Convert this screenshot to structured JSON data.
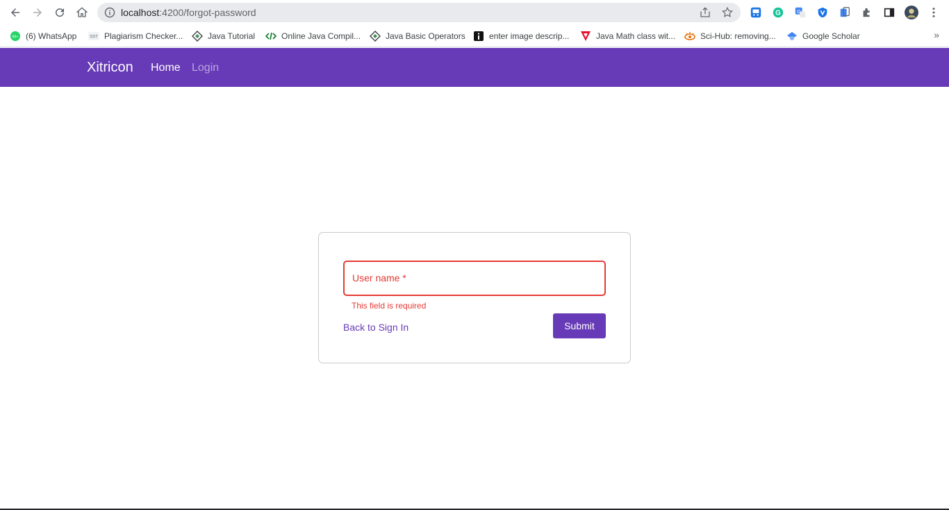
{
  "browser": {
    "url_host": "localhost",
    "url_path": ":4200/forgot-password"
  },
  "bookmarks": [
    {
      "label": "(6) WhatsApp",
      "icon": "whatsapp-icon",
      "badge": "99+"
    },
    {
      "label": "Plagiarism Checker...",
      "icon": "sst-icon",
      "badge": "SST"
    },
    {
      "label": "Java Tutorial",
      "icon": "diamond-icon"
    },
    {
      "label": "Online Java Compil...",
      "icon": "code-icon"
    },
    {
      "label": "Java Basic Operators",
      "icon": "diamond-icon"
    },
    {
      "label": "enter image descrip...",
      "icon": "info-icon"
    },
    {
      "label": "Java Math class wit...",
      "icon": "v-icon"
    },
    {
      "label": "Sci-Hub: removing...",
      "icon": "scihub-icon"
    },
    {
      "label": "Google Scholar",
      "icon": "scholar-icon"
    }
  ],
  "app": {
    "brand": "Xitricon",
    "nav": {
      "home": "Home",
      "login": "Login"
    }
  },
  "form": {
    "field_label": "User name *",
    "error": "This field is required",
    "back_link": "Back to Sign In",
    "submit": "Submit"
  },
  "colors": {
    "primary": "#673ab7",
    "error": "#e53935"
  }
}
